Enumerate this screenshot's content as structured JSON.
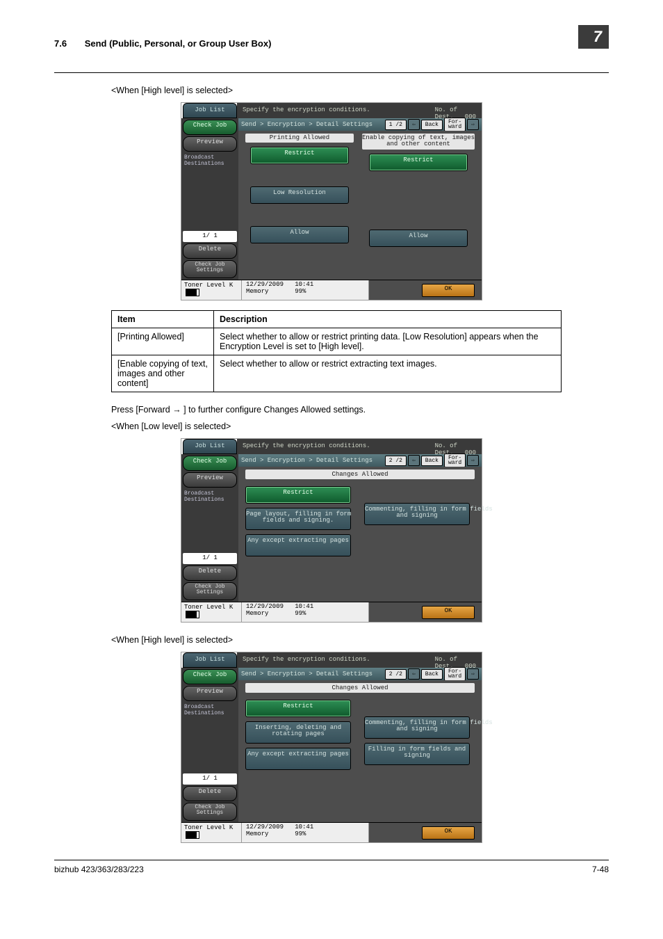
{
  "header": {
    "section_number": "7.6",
    "section_title": "Send (Public, Personal, or Group User Box)",
    "chapter": "7"
  },
  "body": {
    "caption_high1": "<When [High level] is selected>",
    "press_forward": "Press [Forward → ] to further configure Changes Allowed settings.",
    "caption_low": "<When [Low level] is selected>",
    "caption_high2": "<When [High level] is selected>"
  },
  "table": {
    "headers": [
      "Item",
      "Description"
    ],
    "rows": [
      {
        "item": "[Printing Allowed]",
        "desc": "Select whether to allow or restrict printing data. [Low Resolution] appears when the Encryption Level is set to [High level]."
      },
      {
        "item": "[Enable copying of text, images and other content]",
        "desc": "Select whether to allow or restrict extracting text images."
      }
    ]
  },
  "mfp_shared": {
    "spec": "Specify the encryption conditions.",
    "no_of": "No. of\nDest.",
    "dest_count": "000",
    "job_list": "Job List",
    "check_job": "Check Job",
    "preview": "Preview",
    "broadcast": "Broadcast\nDestinations",
    "pane_count": "1/  1",
    "delete": "Delete",
    "check_settings": "Check Job\nSettings",
    "toner": "Toner Level",
    "k": "K",
    "date": "12/29/2009",
    "time": "10:41",
    "mem": "Memory",
    "mempct": "99%",
    "ok": "OK",
    "back": "Back",
    "forward": "For-\nward",
    "breadcrumb": "Send > Encryption > Detail Settings"
  },
  "shot1": {
    "page": "1 /2",
    "col1_head": "Printing Allowed",
    "col2_head": "Enable copying of text, images\nand other content",
    "restrict": "Restrict",
    "lowres": "Low Resolution",
    "allow": "Allow"
  },
  "shot2": {
    "page": "2 /2",
    "head": "Changes Allowed",
    "restrict": "Restrict",
    "opt1": "Page layout, filling in form\nfields and signing.",
    "opt2": "Commenting, filling in form fields\nand signing",
    "opt3": "Any except extracting pages"
  },
  "shot3": {
    "page": "2 /2",
    "head": "Changes Allowed",
    "restrict": "Restrict",
    "opt1": "Inserting, deleting and\nrotating pages",
    "opt2": "Commenting, filling in form fields\nand signing",
    "opt3": "Any except extracting pages",
    "opt4": "Filling in form fields and\nsigning"
  },
  "footer": {
    "model": "bizhub 423/363/283/223",
    "page": "7-48"
  }
}
